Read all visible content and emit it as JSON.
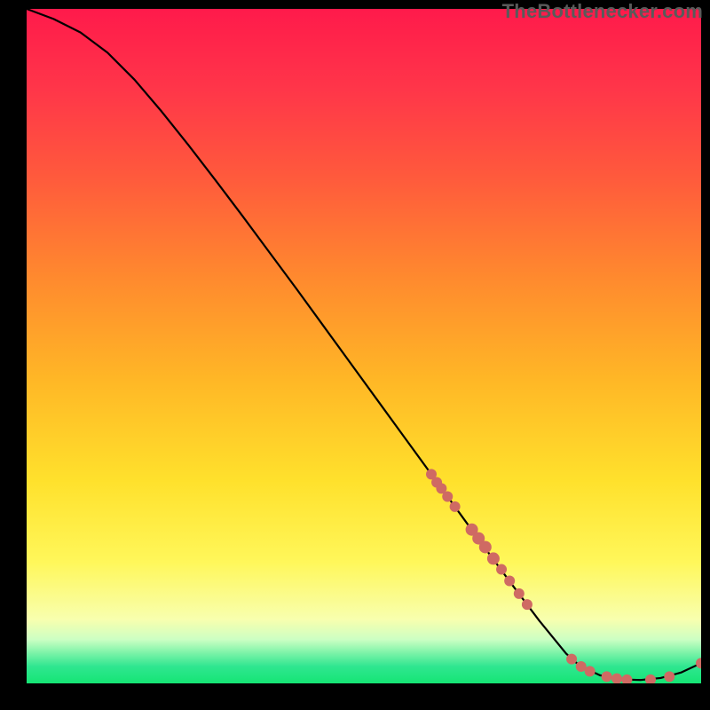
{
  "watermark": "TheBottlenecker.com",
  "gradient": {
    "stops": [
      {
        "offset": 0.0,
        "color": "#ff1a4b"
      },
      {
        "offset": 0.12,
        "color": "#ff3649"
      },
      {
        "offset": 0.25,
        "color": "#ff5a3c"
      },
      {
        "offset": 0.4,
        "color": "#ff8a2e"
      },
      {
        "offset": 0.55,
        "color": "#ffb726"
      },
      {
        "offset": 0.7,
        "color": "#ffe12c"
      },
      {
        "offset": 0.82,
        "color": "#fff75a"
      },
      {
        "offset": 0.905,
        "color": "#f8ffae"
      },
      {
        "offset": 0.935,
        "color": "#ccffc3"
      },
      {
        "offset": 0.955,
        "color": "#7cf3a8"
      },
      {
        "offset": 0.975,
        "color": "#2fe690"
      },
      {
        "offset": 1.0,
        "color": "#15e574"
      }
    ]
  },
  "chart_data": {
    "type": "line",
    "title": "",
    "xlabel": "",
    "ylabel": "",
    "xlim": [
      0,
      100
    ],
    "ylim": [
      0,
      100
    ],
    "grid": false,
    "legend": false,
    "series": [
      {
        "name": "bottleneck-curve",
        "style": "solid",
        "color": "#000000",
        "x": [
          0,
          4,
          8,
          12,
          16,
          20,
          24,
          28,
          32,
          36,
          40,
          44,
          48,
          52,
          56,
          60,
          64,
          68,
          72,
          76,
          80,
          82,
          85,
          88,
          91,
          94,
          97,
          100
        ],
        "y": [
          100,
          98.5,
          96.5,
          93.5,
          89.5,
          84.8,
          79.8,
          74.6,
          69.3,
          63.9,
          58.5,
          53.0,
          47.5,
          42.0,
          36.5,
          31.0,
          25.5,
          20.0,
          14.6,
          9.3,
          4.4,
          2.6,
          1.2,
          0.6,
          0.5,
          0.8,
          1.6,
          3.0
        ]
      },
      {
        "name": "highlight-dots",
        "style": "dotted-heavy",
        "color": "#cf6a63",
        "points": [
          {
            "x": 60.0,
            "y": 31.0,
            "r": 6
          },
          {
            "x": 60.8,
            "y": 29.8,
            "r": 6
          },
          {
            "x": 61.5,
            "y": 28.9,
            "r": 6
          },
          {
            "x": 62.4,
            "y": 27.7,
            "r": 6
          },
          {
            "x": 63.5,
            "y": 26.2,
            "r": 6
          },
          {
            "x": 66.0,
            "y": 22.8,
            "r": 7
          },
          {
            "x": 67.0,
            "y": 21.5,
            "r": 7
          },
          {
            "x": 68.0,
            "y": 20.2,
            "r": 7
          },
          {
            "x": 69.2,
            "y": 18.5,
            "r": 7
          },
          {
            "x": 70.4,
            "y": 16.9,
            "r": 6
          },
          {
            "x": 71.6,
            "y": 15.2,
            "r": 6
          },
          {
            "x": 73.0,
            "y": 13.3,
            "r": 6
          },
          {
            "x": 74.2,
            "y": 11.7,
            "r": 6
          },
          {
            "x": 80.8,
            "y": 3.6,
            "r": 6
          },
          {
            "x": 82.2,
            "y": 2.5,
            "r": 6
          },
          {
            "x": 83.5,
            "y": 1.8,
            "r": 6
          },
          {
            "x": 86.0,
            "y": 1.0,
            "r": 6
          },
          {
            "x": 87.5,
            "y": 0.7,
            "r": 6
          },
          {
            "x": 89.0,
            "y": 0.55,
            "r": 6
          },
          {
            "x": 92.5,
            "y": 0.55,
            "r": 6
          },
          {
            "x": 95.3,
            "y": 1.0,
            "r": 6
          },
          {
            "x": 100.0,
            "y": 3.0,
            "r": 6
          }
        ]
      }
    ]
  }
}
